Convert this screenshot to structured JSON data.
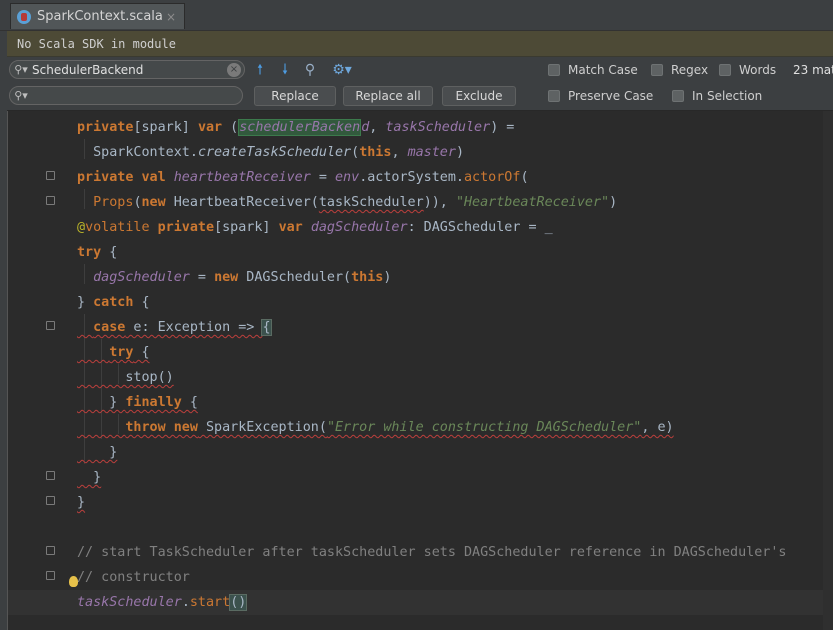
{
  "tab": {
    "title": "SparkContext.scala",
    "close": "×"
  },
  "banner": {
    "text": "No Scala SDK in module"
  },
  "find": {
    "search_value": "SchedulerBackend",
    "replace_value": "",
    "replace_label": "Replace",
    "replace_all_label": "Replace all",
    "exclude_label": "Exclude",
    "match_case_label": "Match Case",
    "regex_label": "Regex",
    "words_label": "Words",
    "preserve_case_label": "Preserve Case",
    "in_selection_label": "In Selection",
    "match_count": "23 mat"
  },
  "code": [
    "private[spark] var (schedulerBackend, taskScheduler) =",
    "  SparkContext.createTaskScheduler(this, master)",
    "private val heartbeatReceiver = env.actorSystem.actorOf(",
    "  Props(new HeartbeatReceiver(taskScheduler)), \"HeartbeatReceiver\")",
    "@volatile private[spark] var dagScheduler: DAGScheduler = _",
    "try {",
    "  dagScheduler = new DAGScheduler(this)",
    "} catch {",
    "  case e: Exception => {",
    "    try {",
    "      stop()",
    "    } finally {",
    "      throw new SparkException(\"Error while constructing DAGScheduler\", e)",
    "    }",
    "  }",
    "}",
    "",
    "// start TaskScheduler after taskScheduler sets DAGScheduler reference in DAGScheduler's",
    "// constructor",
    "taskScheduler.start()"
  ],
  "colors": {
    "editor_bg": "#2b2b2b",
    "keyword": "#cc7832",
    "string": "#6a8759",
    "field": "#9876aa",
    "comment": "#808080"
  }
}
